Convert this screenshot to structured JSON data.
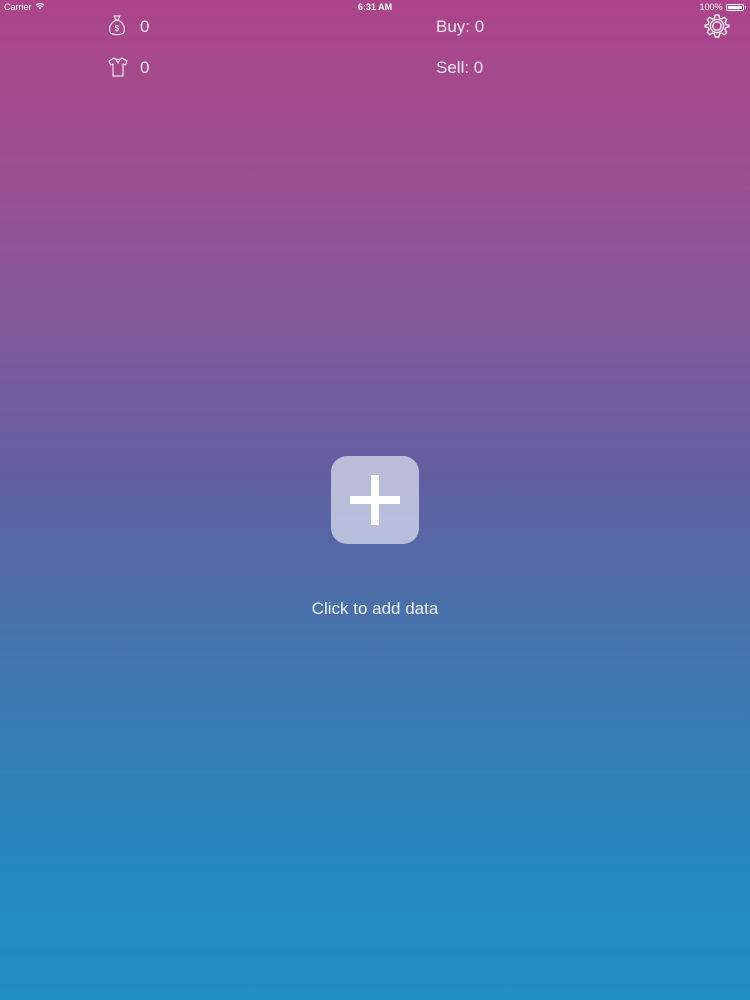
{
  "status_bar": {
    "carrier": "Carrier",
    "time": "6:31 AM",
    "battery_percent": "100%",
    "battery_level": 1.0,
    "wifi_icon": "wifi-icon",
    "battery_icon": "battery-icon"
  },
  "stats": {
    "money_icon": "money-bag-icon",
    "money_value": "0",
    "clothing_icon": "shirt-icon",
    "clothing_value": "0",
    "buy_text": "Buy: 0",
    "sell_text": "Sell: 0"
  },
  "settings": {
    "icon": "gear-icon"
  },
  "empty_state": {
    "add_icon": "plus-icon",
    "label": "Click to add data"
  },
  "colors": {
    "gradient_top": "#ad4489",
    "gradient_bottom": "#1f90c0",
    "add_button_bg": "#dce1f0"
  }
}
